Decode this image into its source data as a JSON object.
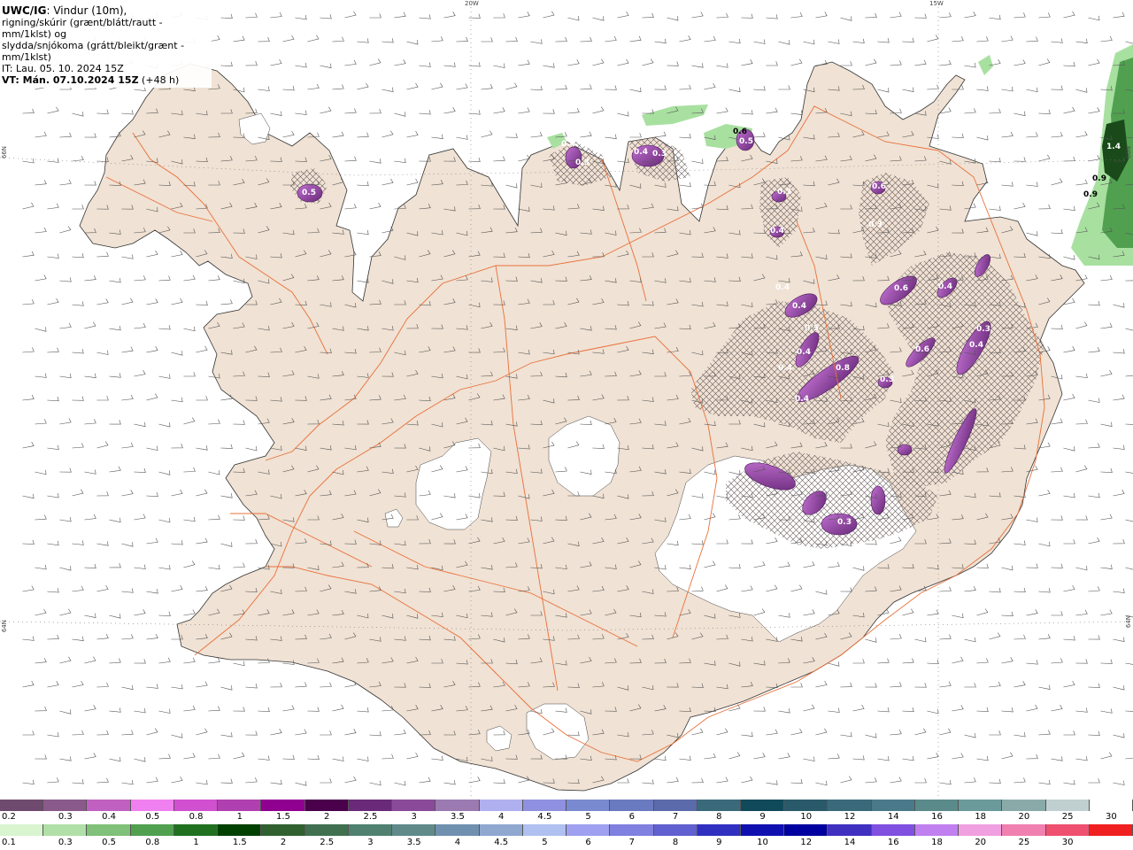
{
  "header": {
    "model": "UWC/IG",
    "line1_rest": ": Vindur (10m),",
    "line2": "rigning/skúrir (grænt/blátt/rautt - mm/1klst) og",
    "line3": "slydda/snjókoma (grátt/bleikt/grænt - mm/1klst)",
    "line4": "IT: Lau. 05. 10. 2024 15Z",
    "line5_label": "VT: Mán. 07.10.2024 15Z",
    "line5_rest": " (+48 h)"
  },
  "grid_labels": {
    "lon_20w": "20W",
    "lon_15w": "15W",
    "lat_66n_left": "66N",
    "lat_66n_right": "66N",
    "lat_64n_left": "64N",
    "lat_64n_right": "64N"
  },
  "map_labels": [
    {
      "text": "0.5",
      "color": "#ffffff"
    },
    {
      "text": "0.4",
      "color": "#ffffff"
    },
    {
      "text": "0.3",
      "color": "#ffffff"
    },
    {
      "text": "0.4",
      "color": "#ffffff"
    },
    {
      "text": "0.3",
      "color": "#ffffff"
    },
    {
      "text": "0.6",
      "color": "#000000"
    },
    {
      "text": "0.5",
      "color": "#ffffff"
    },
    {
      "text": "0.6",
      "color": "#ffffff"
    },
    {
      "text": "0.3",
      "color": "#ffffff"
    },
    {
      "text": "0.4",
      "color": "#ffffff"
    },
    {
      "text": "0.3",
      "color": "#ffffff"
    },
    {
      "text": "0.6",
      "color": "#ffffff"
    },
    {
      "text": "0.4",
      "color": "#ffffff"
    },
    {
      "text": "0.4",
      "color": "#ffffff"
    },
    {
      "text": "0.4",
      "color": "#ffffff"
    },
    {
      "text": "0.5",
      "color": "#ffffff"
    },
    {
      "text": "0.4",
      "color": "#ffffff"
    },
    {
      "text": "0.4",
      "color": "#ffffff"
    },
    {
      "text": "0.6",
      "color": "#ffffff"
    },
    {
      "text": "0.8",
      "color": "#ffffff"
    },
    {
      "text": "0.3",
      "color": "#ffffff"
    },
    {
      "text": "0.4",
      "color": "#ffffff"
    },
    {
      "text": "0.4",
      "color": "#ffffff"
    },
    {
      "text": "0.3",
      "color": "#ffffff"
    },
    {
      "text": "0.3",
      "color": "#ffffff"
    },
    {
      "text": "1.4",
      "color": "#ffffff"
    },
    {
      "text": "0.9",
      "color": "#000000"
    },
    {
      "text": "0.9",
      "color": "#000000"
    }
  ],
  "legend_snow": {
    "colors": [
      "#6e4a6e",
      "#8a5a8a",
      "#c060c0",
      "#f080f0",
      "#d050d0",
      "#b040b0",
      "#900090",
      "#4a004a",
      "#6a2a7a",
      "#8a4a9a",
      "#9a7ab0",
      "#b0b0f0",
      "#9090e0",
      "#7a8ad0",
      "#6a7ac0",
      "#5a6aaa",
      "#3a6a7a",
      "#104a5a",
      "#2a5a6a",
      "#3a6a7a",
      "#4a7a8a",
      "#5a8a8a",
      "#6a9a9a",
      "#8aaaaa",
      "#c0d0d0",
      "#ffffff"
    ],
    "labels": [
      "0.2",
      "0.3",
      "0.4",
      "0.5",
      "0.8",
      "1",
      "1.5",
      "2",
      "2.5",
      "3",
      "3.5",
      "4",
      "4.5",
      "5",
      "6",
      "7",
      "8",
      "9",
      "10",
      "12",
      "14",
      "16",
      "18",
      "20",
      "25",
      "30"
    ]
  },
  "legend_rain": {
    "colors": [
      "#d8f5d0",
      "#b0e0a8",
      "#80c078",
      "#50a050",
      "#207020",
      "#004000",
      "#306030",
      "#407050",
      "#508070",
      "#608a8a",
      "#7090b0",
      "#90a8d0",
      "#b0c0f0",
      "#a0a0f0",
      "#8080e0",
      "#6060d0",
      "#3030c0",
      "#1010b0",
      "#0000a0",
      "#4030c0",
      "#8050e0",
      "#c080f0",
      "#f0a0e0",
      "#f080b0",
      "#f05070",
      "#f02020"
    ],
    "labels": [
      "0.1",
      "0.3",
      "0.5",
      "0.8",
      "1",
      "1.5",
      "2",
      "2.5",
      "3",
      "3.5",
      "4",
      "4.5",
      "5",
      "6",
      "7",
      "8",
      "9",
      "10",
      "12",
      "14",
      "16",
      "18",
      "20",
      "25",
      "30"
    ]
  },
  "colors": {
    "land": "#f0e2d4",
    "ice": "#ffffff",
    "roads": "#e8703a",
    "snow_hatch": "#6a5a5a",
    "precip_snow": "#8a3a9a",
    "precip_rain": "#8ad88a",
    "precip_rain_heavy": "#1a5a2a"
  }
}
